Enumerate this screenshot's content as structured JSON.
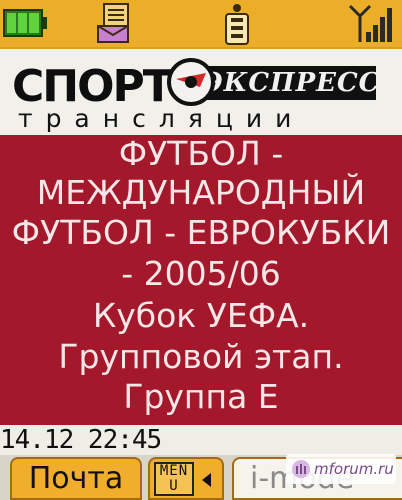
{
  "status_bar": {
    "icons": [
      "battery-icon",
      "mail-icon",
      "sim-card-icon",
      "signal-strength-icon"
    ]
  },
  "header": {
    "logo_main": "СПОРТ",
    "logo_express": "ЭКСПРЕСС",
    "logo_sub": "трансляции"
  },
  "content": {
    "lines": [
      "ФУТБОЛ -",
      "МЕЖДУНАРОДНЫЙ",
      "ФУТБОЛ - ЕВРОКУБКИ",
      "- 2005/06",
      "Кубок УЕФА.",
      "Групповой этап.",
      "Группа Е"
    ]
  },
  "footer": {
    "datetime": "14.12 22:45"
  },
  "softkeys": {
    "left_label": "Почта",
    "menu_label": "MENU",
    "right_label": "i-mode"
  },
  "watermark": {
    "text": "mforum.ru"
  },
  "colors": {
    "status_bar": "#ecae28",
    "content_background": "#a3192b",
    "content_text": "#f5e7e8",
    "softkey": "#f1ae2c"
  }
}
